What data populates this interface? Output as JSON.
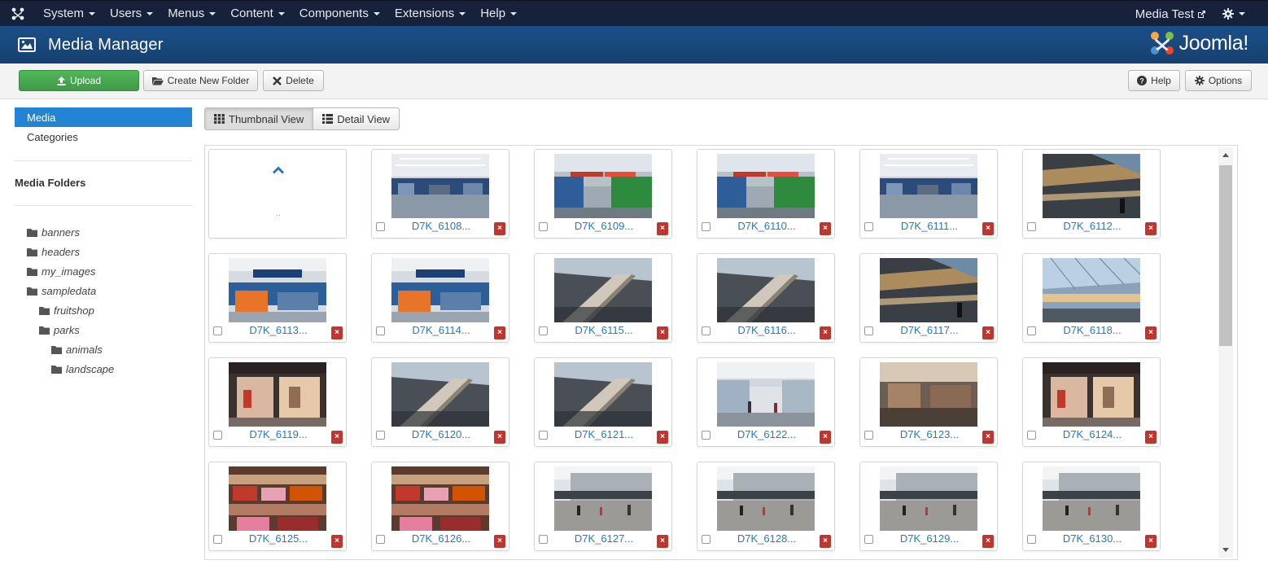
{
  "topnav": {
    "items": [
      {
        "label": "System"
      },
      {
        "label": "Users"
      },
      {
        "label": "Menus"
      },
      {
        "label": "Content"
      },
      {
        "label": "Components"
      },
      {
        "label": "Extensions"
      },
      {
        "label": "Help"
      }
    ],
    "site_link": "Media Test",
    "settings_icon": "gear-icon"
  },
  "header": {
    "title": "Media Manager",
    "logo_text": "Joomla!"
  },
  "toolbar": {
    "upload_label": "Upload",
    "new_folder_label": "Create New Folder",
    "delete_label": "Delete",
    "help_label": "Help",
    "options_label": "Options"
  },
  "sidebar": {
    "links": [
      {
        "label": "Media",
        "active": true
      },
      {
        "label": "Categories",
        "active": false
      }
    ],
    "folders_heading": "Media Folders",
    "folders": [
      {
        "name": "banners",
        "depth": 0
      },
      {
        "name": "headers",
        "depth": 0
      },
      {
        "name": "my_images",
        "depth": 0
      },
      {
        "name": "sampledata",
        "depth": 0
      },
      {
        "name": "fruitshop",
        "depth": 1
      },
      {
        "name": "parks",
        "depth": 1
      },
      {
        "name": "animals",
        "depth": 2
      },
      {
        "name": "landscape",
        "depth": 2
      }
    ]
  },
  "views": {
    "thumbnail_label": "Thumbnail View",
    "detail_label": "Detail View",
    "active": "thumbnail"
  },
  "grid": {
    "up_label": "..",
    "delete_glyph": "×",
    "images": [
      {
        "name": "D7K_6108...",
        "scene": "store-blue"
      },
      {
        "name": "D7K_6109...",
        "scene": "store-green"
      },
      {
        "name": "D7K_6110...",
        "scene": "store-green"
      },
      {
        "name": "D7K_6111...",
        "scene": "store-blue"
      },
      {
        "name": "D7K_6112...",
        "scene": "mall-dark"
      },
      {
        "name": "D7K_6113...",
        "scene": "saturn"
      },
      {
        "name": "D7K_6114...",
        "scene": "saturn"
      },
      {
        "name": "D7K_6115...",
        "scene": "escalator"
      },
      {
        "name": "D7K_6116...",
        "scene": "escalator"
      },
      {
        "name": "D7K_6117...",
        "scene": "mall-dark"
      },
      {
        "name": "D7K_6118...",
        "scene": "mall-glass"
      },
      {
        "name": "D7K_6119...",
        "scene": "shop-front"
      },
      {
        "name": "D7K_6120...",
        "scene": "escalator"
      },
      {
        "name": "D7K_6121...",
        "scene": "escalator"
      },
      {
        "name": "D7K_6122...",
        "scene": "mall-bright"
      },
      {
        "name": "D7K_6123...",
        "scene": "cafe"
      },
      {
        "name": "D7K_6124...",
        "scene": "shop-front"
      },
      {
        "name": "D7K_6125...",
        "scene": "shelves-red"
      },
      {
        "name": "D7K_6126...",
        "scene": "shelves-red"
      },
      {
        "name": "D7K_6127...",
        "scene": "street"
      },
      {
        "name": "D7K_6128...",
        "scene": "street"
      },
      {
        "name": "D7K_6129...",
        "scene": "street"
      },
      {
        "name": "D7K_6130...",
        "scene": "street"
      }
    ]
  },
  "colors": {
    "topnav": "#17223a",
    "header": "#1b4f89",
    "upload": "#46a546",
    "active_link": "#2384d3",
    "filename": "#2a7ab5",
    "delete": "#bd362f"
  }
}
